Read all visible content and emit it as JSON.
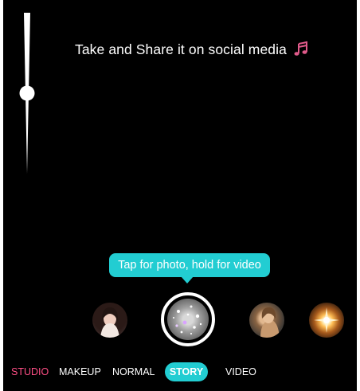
{
  "headline": {
    "text": "Take and Share it on social media",
    "icon": "music-note-icon",
    "icon_color": "#e05a8a"
  },
  "slider": {
    "level": 0.5
  },
  "tooltip": {
    "text": "Tap for photo, hold for video"
  },
  "filters": [
    {
      "name": "portrait-filter-thumb"
    },
    {
      "name": "glitter-filter-thumb",
      "selected": true
    },
    {
      "name": "portrait-filter-thumb-2"
    },
    {
      "name": "sparkle-filter-thumb"
    }
  ],
  "modes": [
    {
      "label": "STUDIO",
      "color": "#ff4f86"
    },
    {
      "label": "MAKEUP"
    },
    {
      "label": "NORMAL"
    },
    {
      "label": "STORY",
      "active": true
    },
    {
      "label": "VIDEO"
    }
  ],
  "colors": {
    "accent": "#22cdd2",
    "studio": "#ff4f86",
    "background": "#000000"
  }
}
